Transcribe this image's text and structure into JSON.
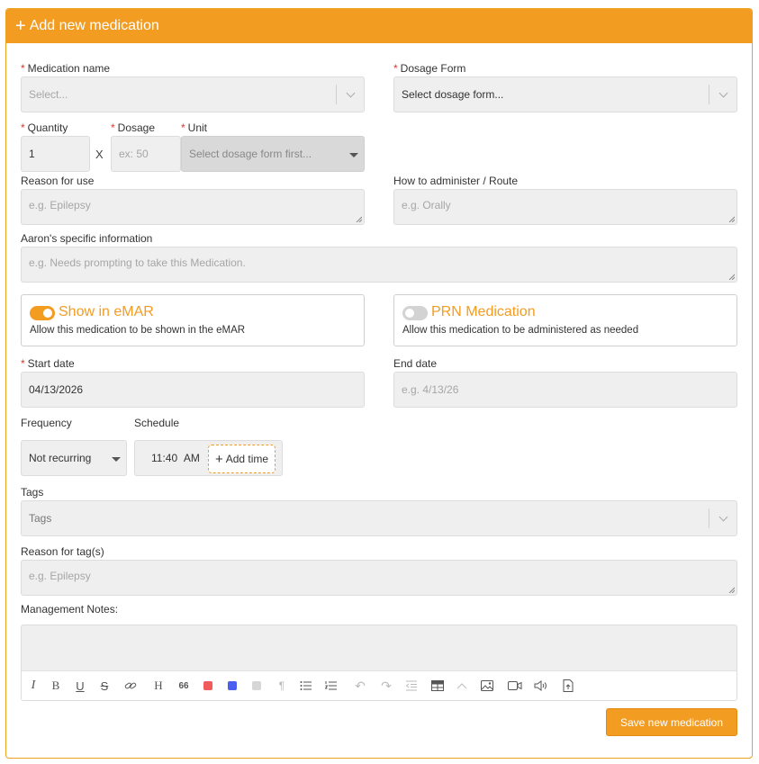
{
  "header": {
    "title": "Add new medication"
  },
  "medication_name": {
    "label": "Medication name",
    "placeholder": "Select..."
  },
  "dosage_form": {
    "label": "Dosage Form",
    "value": "Select dosage form..."
  },
  "quantity": {
    "label": "Quantity",
    "value": "1"
  },
  "times_symbol": "X",
  "dosage": {
    "label": "Dosage",
    "placeholder": "ex: 50"
  },
  "unit": {
    "label": "Unit",
    "value": "Select dosage form first..."
  },
  "reason": {
    "label": "Reason for use",
    "placeholder": "e.g. Epilepsy"
  },
  "route": {
    "label": "How to administer / Route",
    "placeholder": "e.g. Orally"
  },
  "specific": {
    "label": "Aaron's specific information",
    "placeholder": "e.g. Needs prompting to take this Medication."
  },
  "emar": {
    "title": "Show in eMAR",
    "desc": "Allow this medication to be shown in the eMAR",
    "on": true
  },
  "prn": {
    "title": "PRN Medication",
    "desc": "Allow this medication to be administered as needed",
    "on": false
  },
  "start_date": {
    "label": "Start date",
    "value": "04/13/2026"
  },
  "end_date": {
    "label": "End date",
    "placeholder": "e.g. 4/13/26"
  },
  "frequency": {
    "label": "Frequency",
    "value": "Not recurring"
  },
  "schedule": {
    "label": "Schedule",
    "time": "11:40",
    "ampm": "AM",
    "add_label": "Add time"
  },
  "tags": {
    "label": "Tags",
    "placeholder": "Tags"
  },
  "tag_reason": {
    "label": "Reason for tag(s)",
    "placeholder": "e.g. Epilepsy"
  },
  "notes": {
    "label": "Management Notes:"
  },
  "toolbar": {
    "heading_glyph": "H",
    "quote_glyph": "66",
    "colors": {
      "red": "#f25b5b",
      "blue": "#4a5ef0",
      "gray": "#d6d6d6"
    }
  },
  "save_button": {
    "label": "Save new medication"
  },
  "colors": {
    "accent": "#f39c22",
    "required": "#e0352b",
    "field_bg": "#efefef"
  }
}
